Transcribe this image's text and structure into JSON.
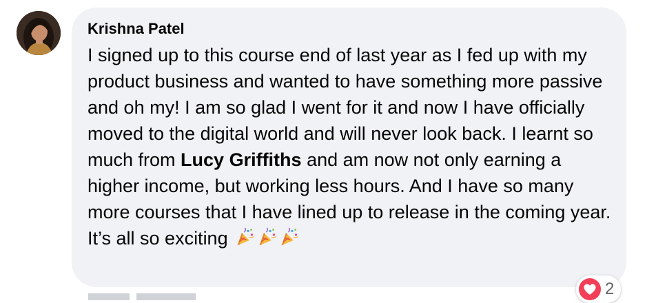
{
  "comment": {
    "author": "Krishna Patel",
    "text_before_mention": "I signed up to this course end of last year as I fed up with my product business and wanted to have something more passive and oh my! I am so glad I went for it and now I have officially moved to the digital world and will never look back. I learnt so much from",
    "mention": "Lucy Griffiths",
    "text_after_mention": "and am now not only earning a higher income, but working less hours. And I have so many more courses that I have lined up to release in the coming year. It’s all so exciting",
    "emoji": [
      "party-popper-icon",
      "party-popper-icon",
      "party-popper-icon"
    ]
  },
  "reactions": {
    "type": "heart-icon",
    "count": "2"
  },
  "colors": {
    "bubble_bg": "#f0f2f5",
    "text": "#050505",
    "heart": "#f33e58"
  }
}
